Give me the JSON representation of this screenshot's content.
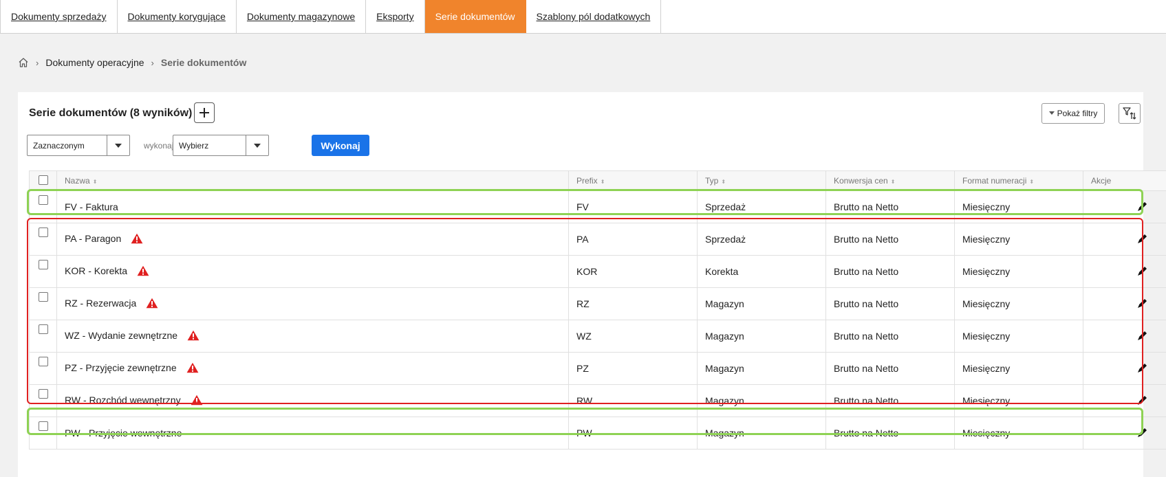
{
  "tabs": [
    {
      "label": "Dokumenty sprzedaży",
      "active": false
    },
    {
      "label": "Dokumenty korygujące",
      "active": false
    },
    {
      "label": "Dokumenty magazynowe",
      "active": false
    },
    {
      "label": "Eksporty",
      "active": false
    },
    {
      "label": "Serie dokumentów",
      "active": true
    },
    {
      "label": "Szablony pól dodatkowych",
      "active": false
    }
  ],
  "breadcrumb": {
    "parent": "Dokumenty operacyjne",
    "current": "Serie dokumentów"
  },
  "panel": {
    "title": "Serie dokumentów (8 wyników)",
    "show_filters_label": "Pokaż filtry",
    "bulk_scope_value": "Zaznaczonym",
    "execute_label": "wykonaj",
    "action_value": "Wybierz",
    "run_button_label": "Wykonaj"
  },
  "table": {
    "headers": {
      "name": "Nazwa",
      "prefix": "Prefix",
      "type": "Typ",
      "conversion": "Konwersja cen",
      "format": "Format numeracji",
      "actions": "Akcje"
    },
    "rows": [
      {
        "name": "FV - Faktura",
        "prefix": "FV",
        "type": "Sprzedaż",
        "conversion": "Brutto na Netto",
        "format": "Miesięczny",
        "warning": false
      },
      {
        "name": "PA - Paragon",
        "prefix": "PA",
        "type": "Sprzedaż",
        "conversion": "Brutto na Netto",
        "format": "Miesięczny",
        "warning": true
      },
      {
        "name": "KOR - Korekta",
        "prefix": "KOR",
        "type": "Korekta",
        "conversion": "Brutto na Netto",
        "format": "Miesięczny",
        "warning": true
      },
      {
        "name": "RZ - Rezerwacja",
        "prefix": "RZ",
        "type": "Magazyn",
        "conversion": "Brutto na Netto",
        "format": "Miesięczny",
        "warning": true
      },
      {
        "name": "WZ - Wydanie zewnętrzne",
        "prefix": "WZ",
        "type": "Magazyn",
        "conversion": "Brutto na Netto",
        "format": "Miesięczny",
        "warning": true
      },
      {
        "name": "PZ - Przyjęcie zewnętrzne",
        "prefix": "PZ",
        "type": "Magazyn",
        "conversion": "Brutto na Netto",
        "format": "Miesięczny",
        "warning": true
      },
      {
        "name": "RW - Rozchód wewnętrzny",
        "prefix": "RW",
        "type": "Magazyn",
        "conversion": "Brutto na Netto",
        "format": "Miesięczny",
        "warning": true
      },
      {
        "name": "PW - Przyjęcie wewnętrzne",
        "prefix": "PW",
        "type": "Magazyn",
        "conversion": "Brutto na Netto",
        "format": "Miesięczny",
        "warning": false
      }
    ]
  },
  "colors": {
    "accent": "#f0842c",
    "primary": "#1a73e8",
    "warning": "#e02020",
    "highlight_ok": "#8ed254",
    "highlight_bad": "#e02020"
  },
  "icons": {
    "home": "home-icon",
    "add": "plus-icon",
    "sort": "filter-sort-icon",
    "edit": "pencil-icon",
    "warning": "warning-triangle-icon"
  }
}
